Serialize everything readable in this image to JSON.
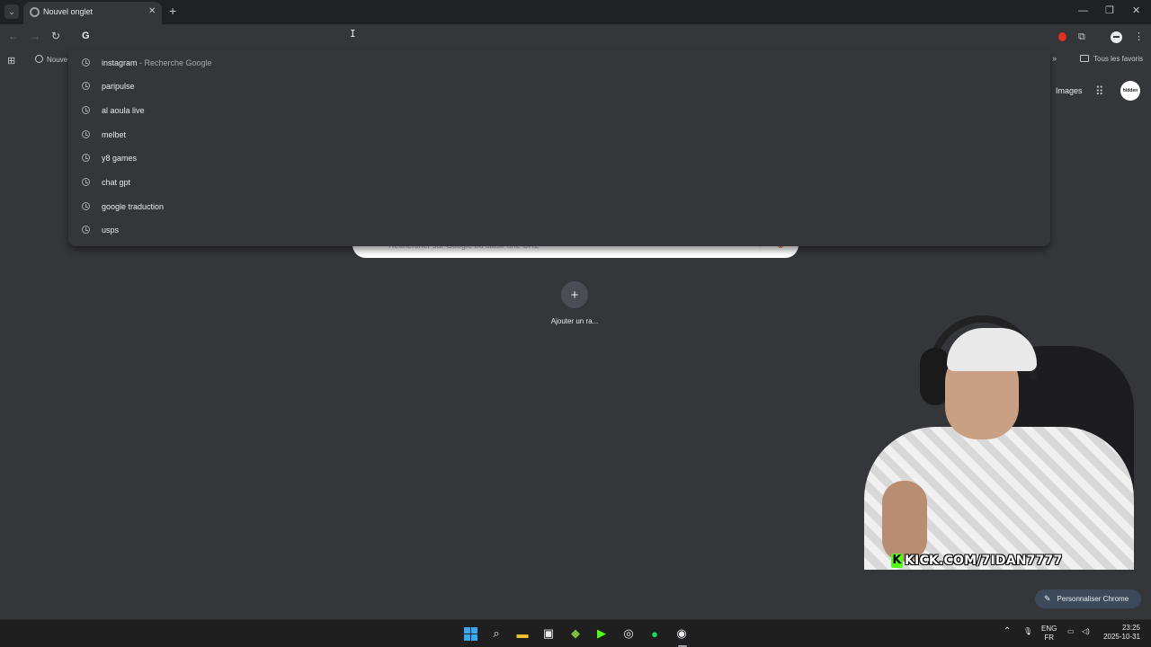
{
  "browser": {
    "tab_title": "Nouvel onglet",
    "omnibox_text": "G",
    "bookmark_item": "Nouve",
    "all_bookmarks": "Tous les favoris"
  },
  "dropdown": {
    "suggestions": [
      {
        "text": "instagram",
        "sub": " - Recherche Google"
      },
      {
        "text": "paripulse",
        "sub": ""
      },
      {
        "text": "al aoula live",
        "sub": ""
      },
      {
        "text": "melbet",
        "sub": ""
      },
      {
        "text": "y8 games",
        "sub": ""
      },
      {
        "text": "chat gpt",
        "sub": ""
      },
      {
        "text": "google traduction",
        "sub": ""
      },
      {
        "text": "usps",
        "sub": ""
      }
    ]
  },
  "ntp": {
    "images_link": "Images",
    "avatar_text": "hidden",
    "search_placeholder": "Rechercher sur Google ou saisir une URL",
    "add_shortcut_label": "Ajouter un ra...",
    "customize_label": "Personnaliser Chrome"
  },
  "overlay": {
    "kick_url": "KICK.COM/7IDAN7777"
  },
  "taskbar": {
    "lang_top": "ENG",
    "lang_bottom": "FR",
    "time": "23:25",
    "date": "2025-10-31"
  },
  "colors": {
    "background": "#35363a",
    "tabstrip": "#202124",
    "kick_green": "#53fc18",
    "windows_blue": "#3aa7f2"
  }
}
